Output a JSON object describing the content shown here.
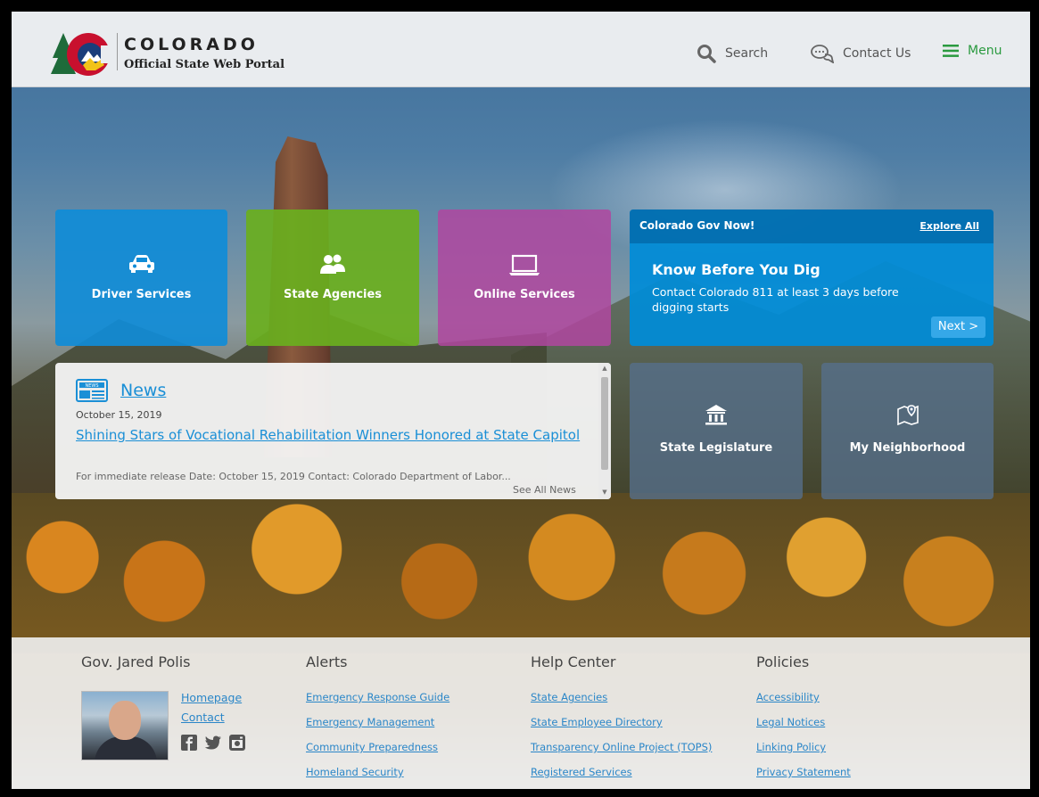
{
  "header": {
    "brand_title": "COLORADO",
    "brand_subtitle": "Official State Web Portal",
    "search_label": "Search",
    "contact_label": "Contact Us",
    "menu_label": "Menu"
  },
  "tiles": {
    "driver": "Driver Services",
    "agencies": "State Agencies",
    "online": "Online Services",
    "legislature": "State Legislature",
    "neighborhood": "My Neighborhood"
  },
  "govnow": {
    "title": "Colorado Gov Now!",
    "explore": "Explore All",
    "headline": "Know Before You Dig",
    "text": "Contact Colorado 811 at least 3 days before digging starts",
    "next": "Next >"
  },
  "news": {
    "title": "News",
    "date": "October 15, 2019",
    "headline": "Shining Stars of Vocational Rehabilitation Winners Honored at State Capitol",
    "snippet": "For immediate release Date: October 15, 2019 Contact: Colorado Department of Labor...",
    "see_all": "See All News"
  },
  "footer": {
    "governor": {
      "title": "Gov. Jared Polis",
      "links": [
        "Homepage",
        "Contact"
      ]
    },
    "alerts": {
      "title": "Alerts",
      "links": [
        "Emergency Response Guide",
        "Emergency Management",
        "Community Preparedness",
        "Homeland Security"
      ]
    },
    "help": {
      "title": "Help Center",
      "links": [
        "State Agencies",
        "State Employee Directory",
        "Transparency Online Project (TOPS)",
        "Registered Services"
      ]
    },
    "policies": {
      "title": "Policies",
      "links": [
        "Accessibility",
        "Legal Notices",
        "Linking Policy",
        "Privacy Statement"
      ]
    }
  },
  "colors": {
    "accent_blue": "#1a8fd6",
    "menu_green": "#2a9a3f",
    "driver_tile": "#108cd7",
    "agencies_tile": "#6aaf1e",
    "online_tile": "#b046a0",
    "slate_tile": "#56708c"
  },
  "icons": {
    "search": "search-icon",
    "contact": "chat-bubbles-icon",
    "menu": "hamburger-icon",
    "driver": "car-icon",
    "agencies": "people-icon",
    "online": "laptop-icon",
    "legislature": "capitol-building-icon",
    "neighborhood": "map-pin-icon",
    "news": "newspaper-icon",
    "social": [
      "facebook-icon",
      "twitter-icon",
      "instagram-icon"
    ]
  }
}
